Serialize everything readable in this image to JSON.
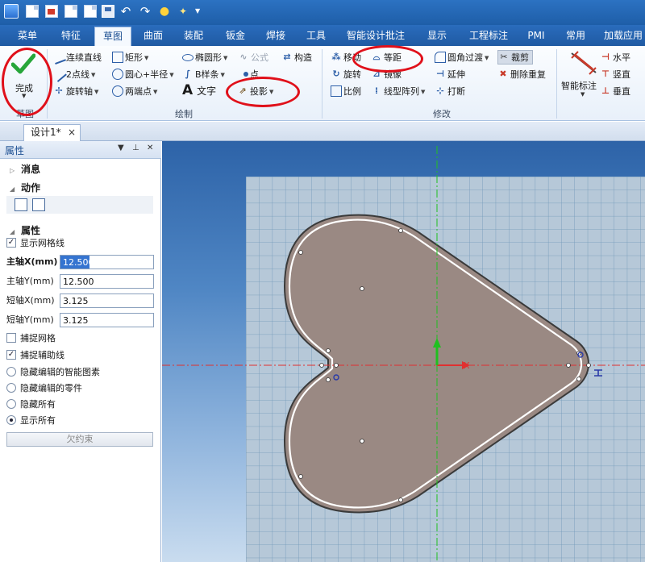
{
  "quick_access": {
    "icons": [
      "app-logo-icon",
      "new-file-icon",
      "open-file-icon",
      "import-icon",
      "print-icon",
      "save-icon",
      "undo-icon",
      "redo-icon",
      "lightbulb-icon",
      "smart-select-icon",
      "dropdown-icon"
    ]
  },
  "ribbon_tabs": [
    {
      "label": "菜单"
    },
    {
      "label": "特征"
    },
    {
      "label": "草图",
      "active": true
    },
    {
      "label": "曲面"
    },
    {
      "label": "装配"
    },
    {
      "label": "钣金"
    },
    {
      "label": "焊接"
    },
    {
      "label": "工具"
    },
    {
      "label": "智能设计批注"
    },
    {
      "label": "显示"
    },
    {
      "label": "工程标注"
    },
    {
      "label": "PMI"
    },
    {
      "label": "常用"
    },
    {
      "label": "加载应用"
    }
  ],
  "ribbon": {
    "finish": {
      "label": "完成",
      "group": "草图"
    },
    "draw": {
      "group": "绘制",
      "continuous_line": "连续直线",
      "two_point_line": "2点线",
      "rotate_axis": "旋转轴",
      "rectangle": "矩形",
      "center_radius": "圆心+半径",
      "two_end_points": "两端点",
      "ellipse": "椭圆形",
      "b_spline": "B样条",
      "text": "文字",
      "formula": "公式",
      "point": "点",
      "projection": "投影",
      "construct": "构造"
    },
    "modify": {
      "group": "修改",
      "move": "移动",
      "offset": "等距",
      "fillet": "圆角过渡",
      "trim": "裁剪",
      "rotate": "旋转",
      "mirror": "镜像",
      "extend": "延伸",
      "delete_duplicates": "删除重复",
      "scale": "比例",
      "linear_array": "线型阵列",
      "break": "打断"
    },
    "dimension": {
      "smart": "智能标注",
      "horizontal": "水平",
      "vertical": "竖直",
      "perpendicular": "垂直"
    }
  },
  "document_tab": {
    "label": "设计1*",
    "close": "×"
  },
  "properties": {
    "title": "属性",
    "sections": {
      "messages": "消息",
      "actions": "动作",
      "properties": "属性"
    },
    "show_grid": {
      "label": "显示网格线",
      "checked": true
    },
    "major_x": {
      "label": "主轴X(mm)",
      "value": "12.500"
    },
    "major_y": {
      "label": "主轴Y(mm)",
      "value": "12.500"
    },
    "minor_x": {
      "label": "短轴X(mm)",
      "value": "3.125"
    },
    "minor_y": {
      "label": "短轴Y(mm)",
      "value": "3.125"
    },
    "snap_grid": {
      "label": "捕捉网格",
      "checked": false
    },
    "snap_aux": {
      "label": "捕捉辅助线",
      "checked": true
    },
    "radios": [
      {
        "label": "隐藏编辑的智能图素",
        "selected": false
      },
      {
        "label": "隐藏编辑的零件",
        "selected": false
      },
      {
        "label": "隐藏所有",
        "selected": false
      },
      {
        "label": "显示所有",
        "selected": true
      }
    ],
    "under_constrained": "欠约束"
  },
  "canvas": {
    "axis_x_label": "X",
    "colors": {
      "shape_fill": "#9a8983",
      "offset_line": "#ffffff",
      "grid": "#6f98b8",
      "axis_center": "#e03030",
      "axis_vertical": "#20c020"
    }
  },
  "annotations": {
    "highlight_color": "#e0101a"
  }
}
